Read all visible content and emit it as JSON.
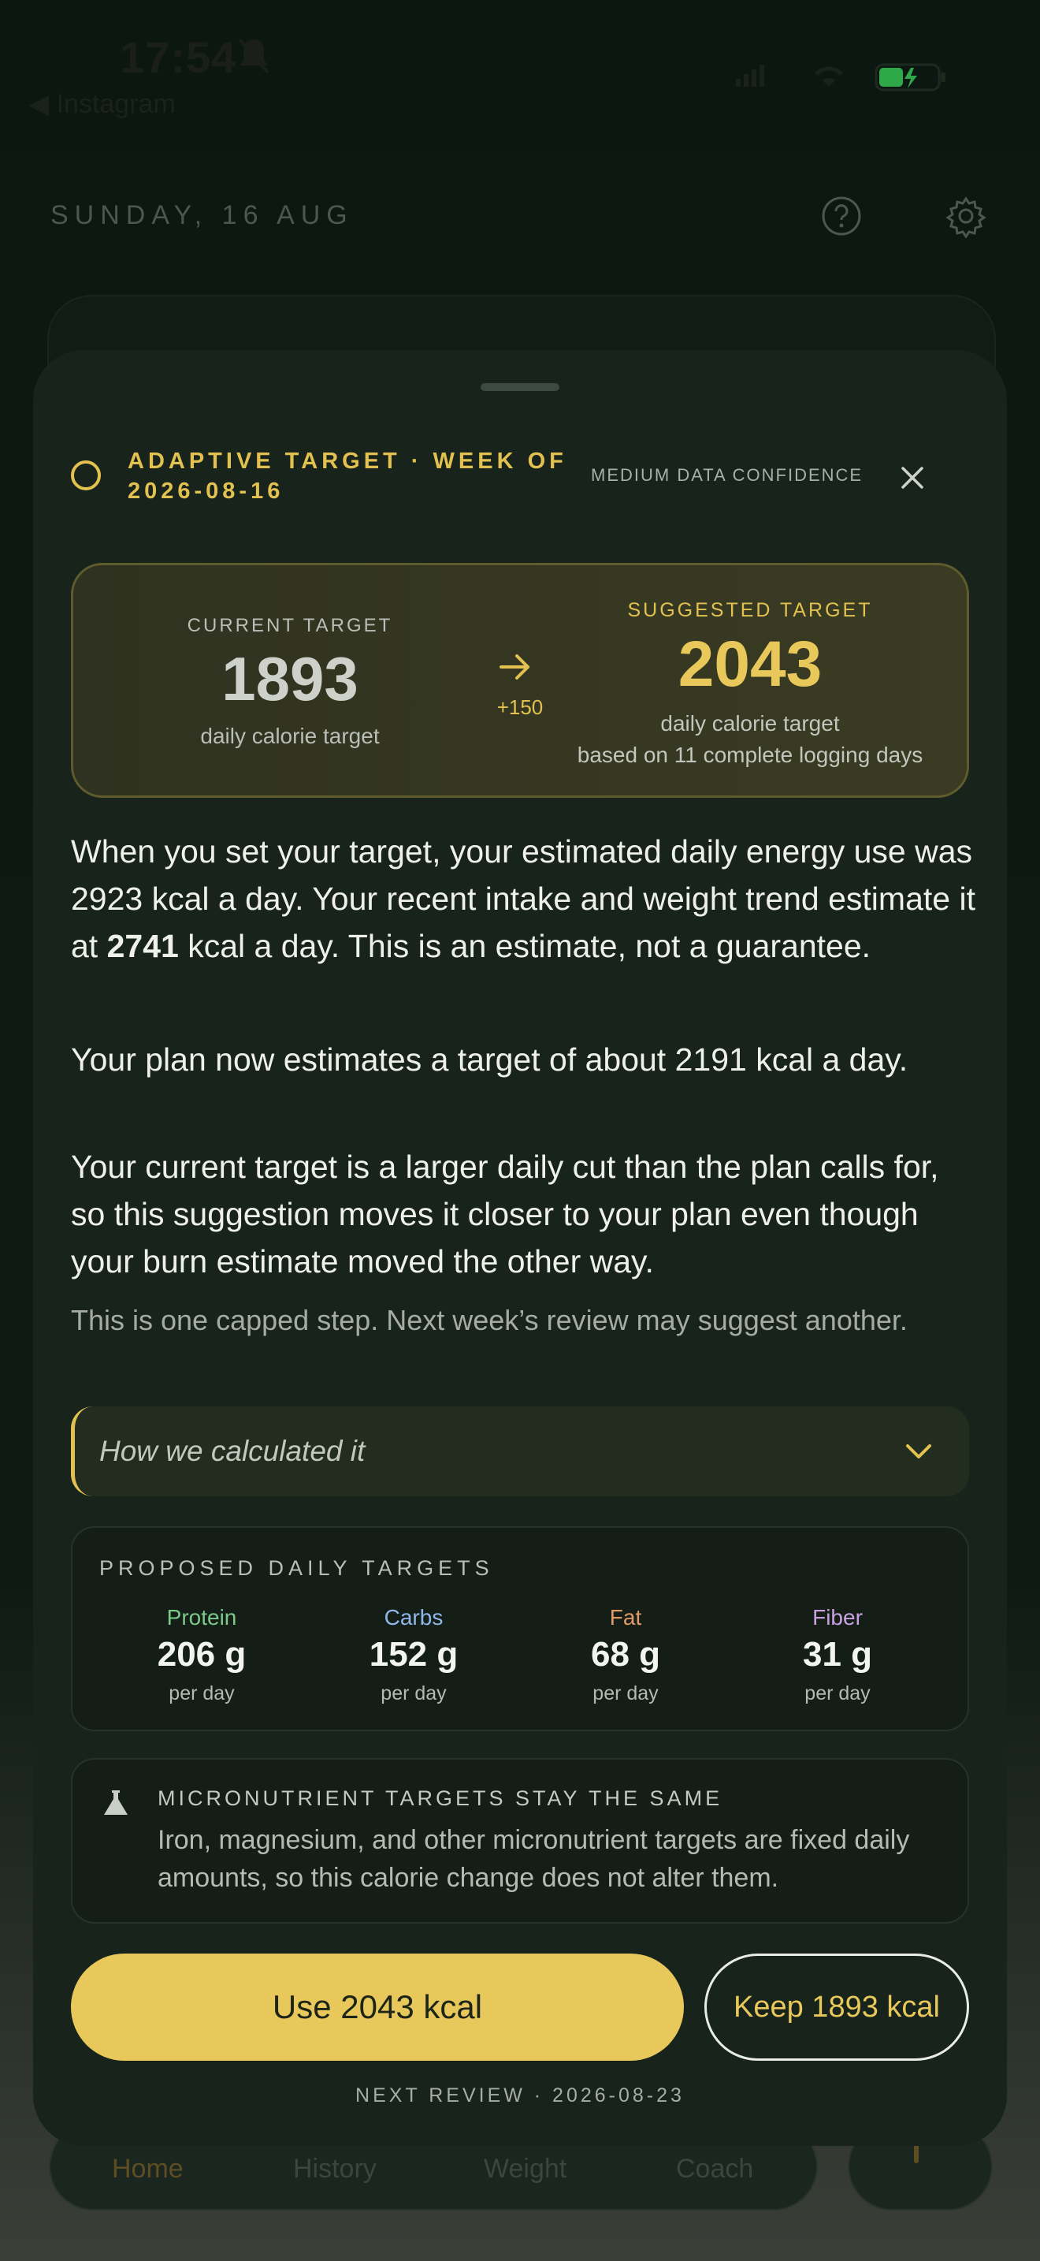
{
  "status_bar": {
    "time": "17:54",
    "back_app": "◀ Instagram"
  },
  "header": {
    "date": "SUNDAY, 16 AUG"
  },
  "tabs": [
    "Home",
    "History",
    "Weight",
    "Coach"
  ],
  "sheet": {
    "title": "ADAPTIVE TARGET · WEEK OF 2026-08-16",
    "confidence": "MEDIUM DATA CONFIDENCE",
    "current": {
      "label": "CURRENT TARGET",
      "value": "1893",
      "sub": "daily calorie target"
    },
    "delta": "+150",
    "suggested": {
      "label": "SUGGESTED TARGET",
      "value": "2043",
      "sub1": "daily calorie target",
      "sub2": "based on 11 complete logging days"
    },
    "p1_a": "When you set your target, your estimated daily energy use was 2923 kcal a day. Your recent intake and weight trend estimate it at ",
    "p1_bold": "2741",
    "p1_b": " kcal a day. This is an estimate, not a guarantee.",
    "p2": "Your plan now estimates a target of about 2191 kcal a day.",
    "p3": "Your current target is a larger daily cut than the plan calls for, so this suggestion moves it closer to your plan even though your burn estimate moved the other way.",
    "note": "This is one capped step. Next week’s review may suggest another.",
    "disclosure": "How we calculated it",
    "macros_title": "PROPOSED DAILY TARGETS",
    "macros": [
      {
        "name": "Protein",
        "value": "206 g",
        "unit": "per day"
      },
      {
        "name": "Carbs",
        "value": "152 g",
        "unit": "per day"
      },
      {
        "name": "Fat",
        "value": "68 g",
        "unit": "per day"
      },
      {
        "name": "Fiber",
        "value": "31 g",
        "unit": "per day"
      }
    ],
    "micro_title": "MICRONUTRIENT TARGETS STAY THE SAME",
    "micro_body": "Iron, magnesium, and other micronutrient targets are fixed daily amounts, so this calorie change does not alter them.",
    "use_label": "Use 2043 kcal",
    "keep_label": "Keep 1893 kcal",
    "next_review": "NEXT REVIEW · 2026-08-23"
  },
  "colors": {
    "accent": "#e8c85a",
    "protein": "#7cc98a",
    "carbs": "#8fb8e8",
    "fat": "#e39a6a",
    "fiber": "#c8a2e0"
  }
}
